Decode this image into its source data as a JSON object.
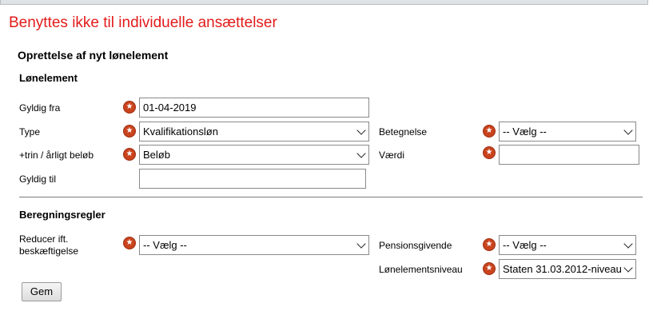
{
  "warning": "Benyttes ikke til individuelle ansættelser",
  "form_title": "Oprettelse af nyt lønelement",
  "sections": {
    "lonelement": "Lønelement",
    "beregningsregler": "Beregningsregler"
  },
  "fields": {
    "gyldig_fra": {
      "label": "Gyldig fra",
      "value": "01-04-2019"
    },
    "type": {
      "label": "Type",
      "value": "Kvalifikationsløn"
    },
    "betegnelse": {
      "label": "Betegnelse",
      "value": "-- Vælg --"
    },
    "trin_belob": {
      "label": "+trin / årligt beløb",
      "value": "Beløb"
    },
    "vaerdi": {
      "label": "Værdi",
      "value": ""
    },
    "gyldig_til": {
      "label": "Gyldig til",
      "value": ""
    },
    "reducer": {
      "label_line1": "Reducer ift.",
      "label_line2": "beskæftigelse",
      "value": "-- Vælg --"
    },
    "pensionsgivende": {
      "label": "Pensionsgivende",
      "value": "-- Vælg --"
    },
    "lonelementsniveau": {
      "label": "Lønelementsniveau",
      "value": "Staten 31.03.2012-niveau"
    }
  },
  "buttons": {
    "save": "Gem"
  },
  "icons": {
    "required": "required-star-icon",
    "dropdown": "chevron-down-icon"
  },
  "colors": {
    "warning_text": "#e31b1b",
    "required_icon": "#c9431d"
  }
}
